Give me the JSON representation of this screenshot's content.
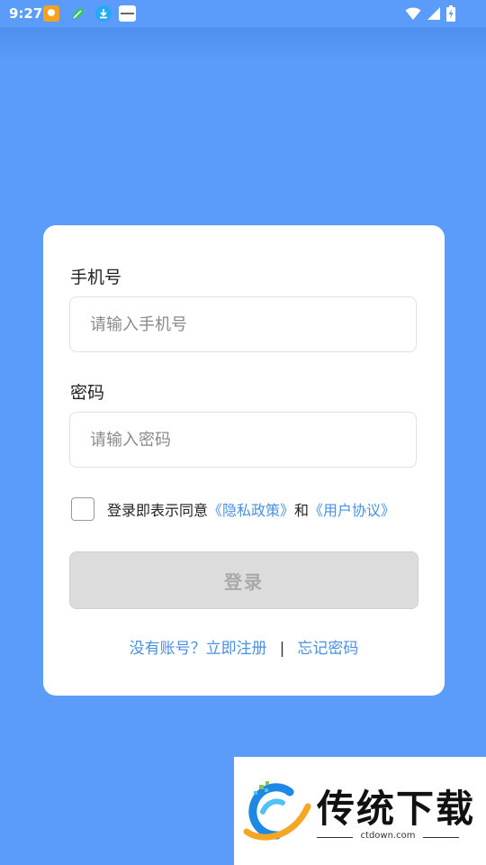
{
  "status_bar": {
    "time": "9:27",
    "icons": [
      "app-notification-icon",
      "leaf-app-icon",
      "download-icon",
      "app-icon",
      "wifi-icon",
      "signal-icon",
      "battery-charging-icon"
    ]
  },
  "form": {
    "phone_label": "手机号",
    "phone_placeholder": "请输入手机号",
    "password_label": "密码",
    "password_placeholder": "请输入密码",
    "agree_prefix": "登录即表示同意",
    "privacy_link": "《隐私政策》",
    "agree_and": "和",
    "user_agreement_link": "《用户协议》",
    "login_button": "登录",
    "register_link": "没有账号？立即注册",
    "separator": "|",
    "forgot_password_link": "忘记密码"
  },
  "watermark": {
    "title": "传统下载",
    "site": "ctdown.com"
  },
  "colors": {
    "background": "#5b9cfb",
    "link": "#4a90e2",
    "button_disabled": "#dcdcdc"
  }
}
